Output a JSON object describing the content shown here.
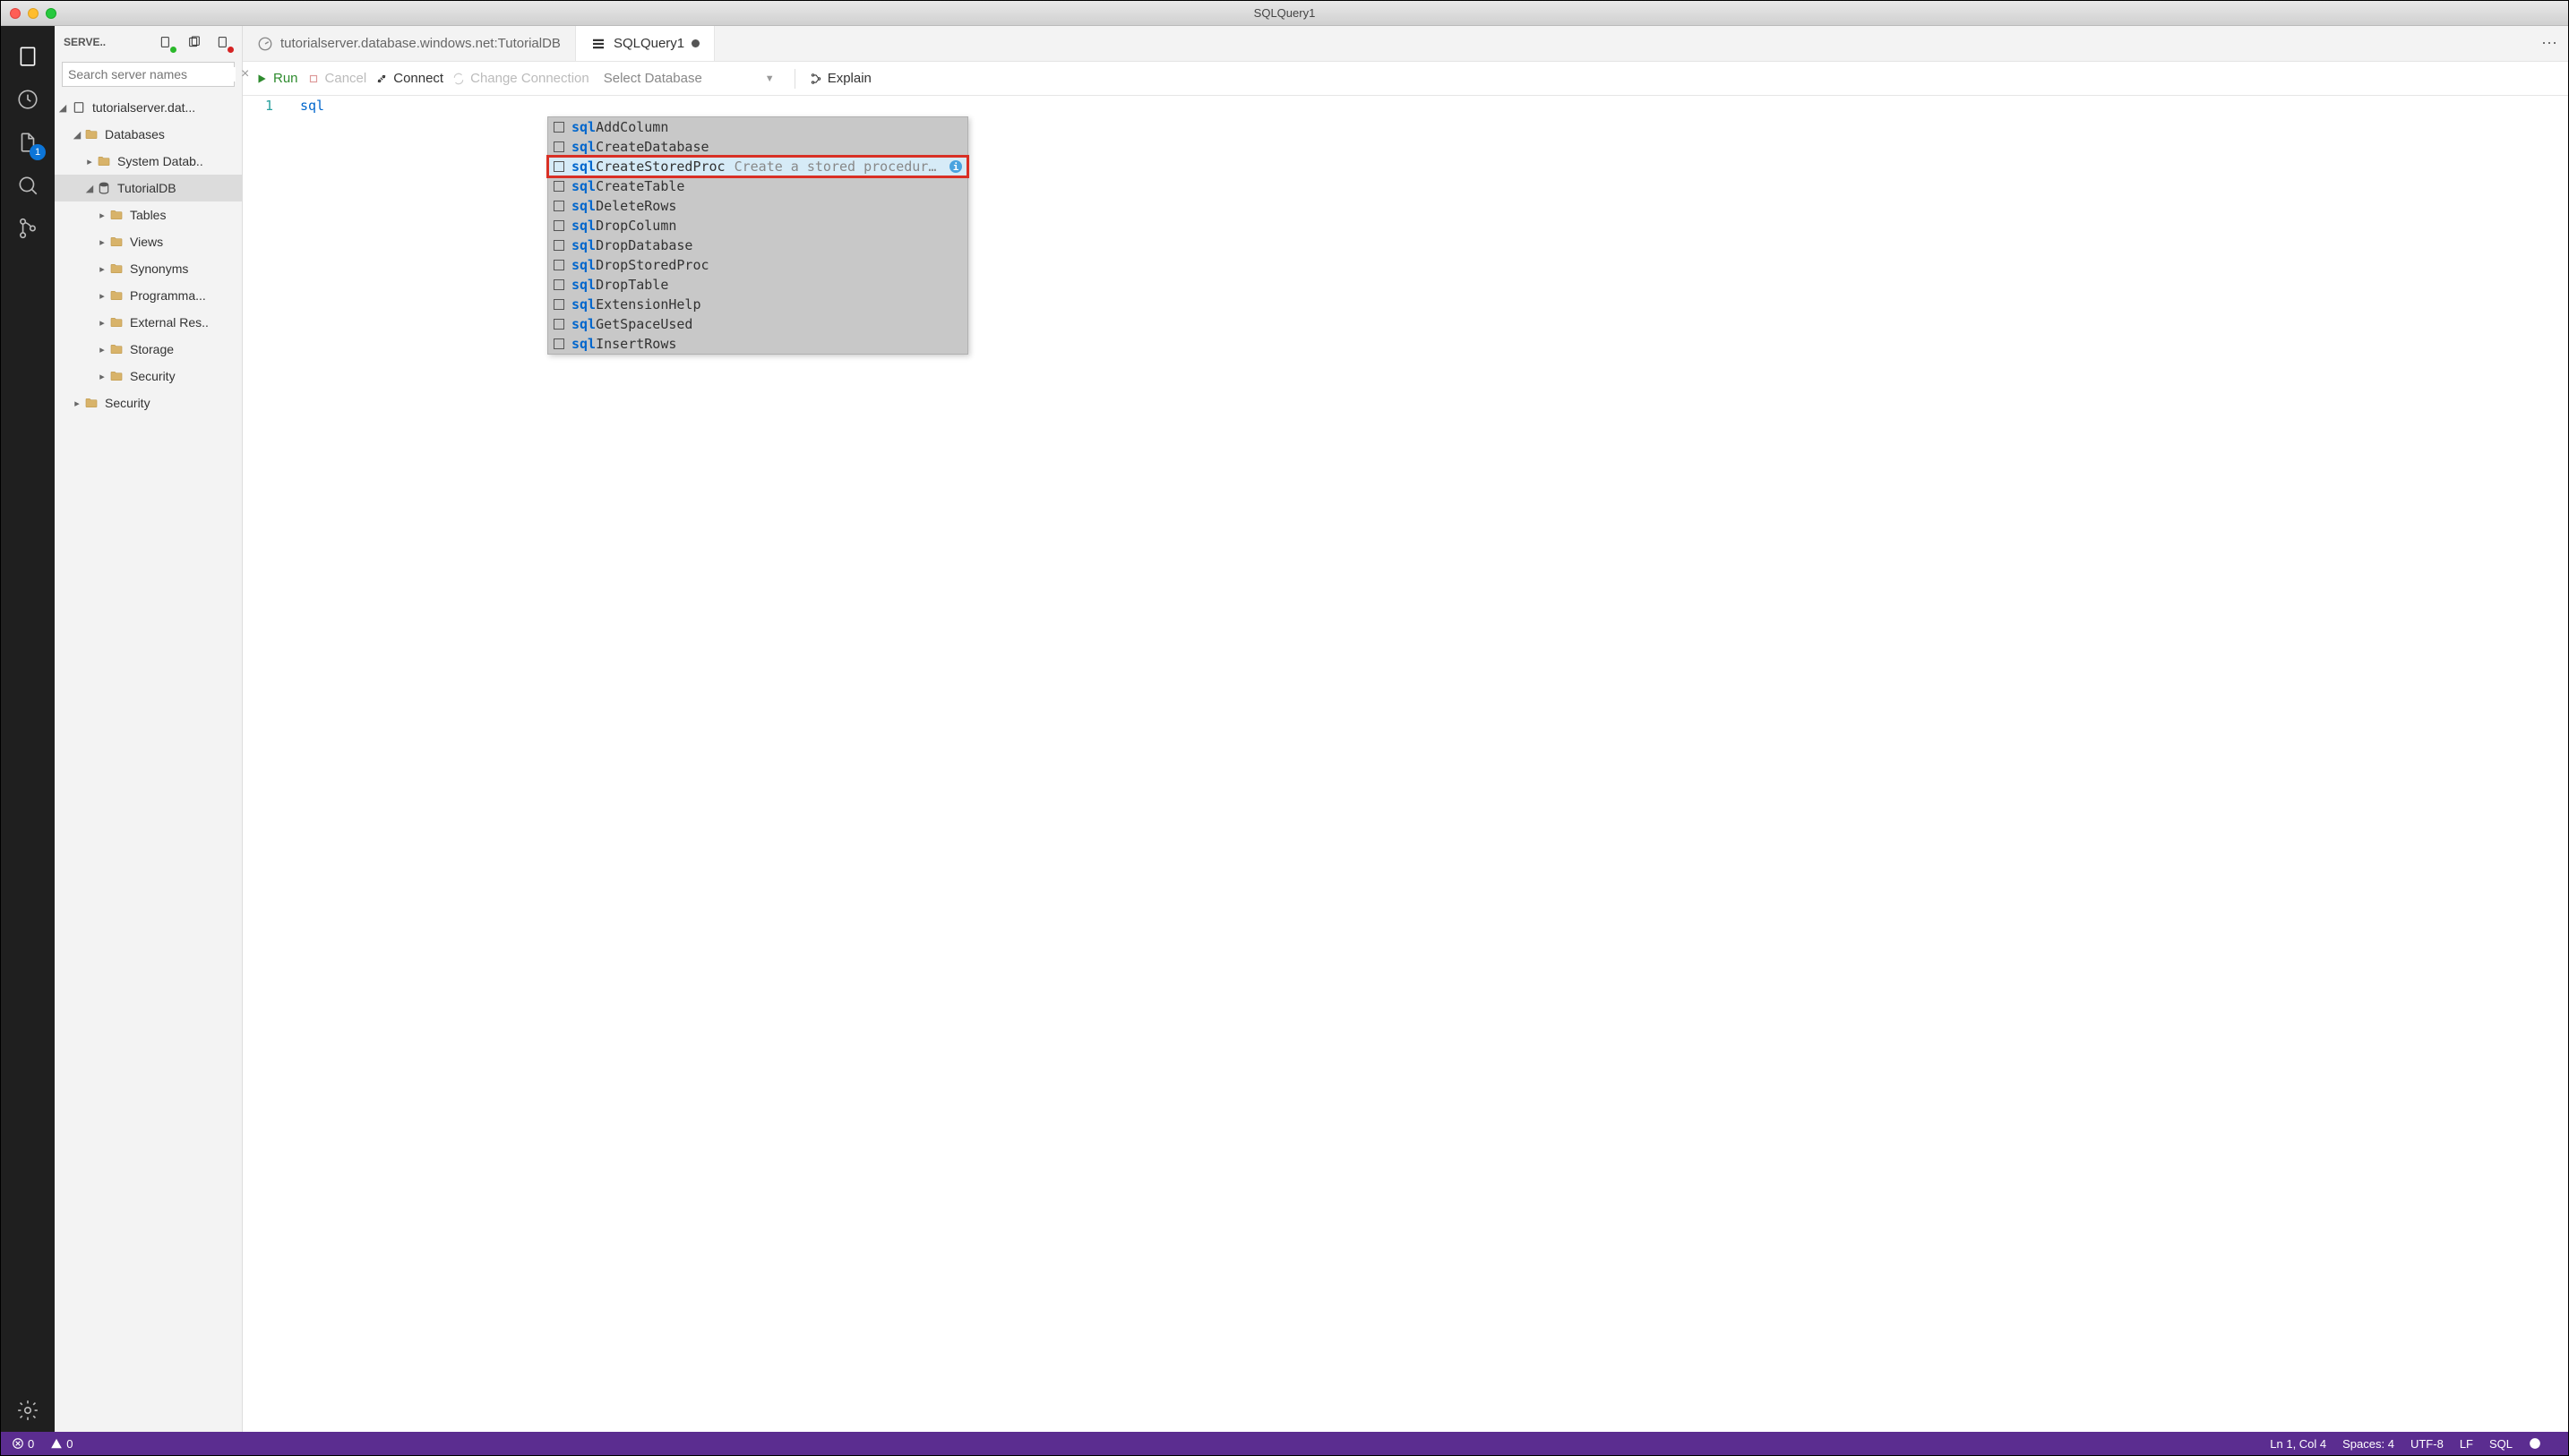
{
  "window": {
    "title": "SQLQuery1"
  },
  "activityBar": {
    "badge": "1"
  },
  "sidebar": {
    "headerLabel": "SERVE..",
    "searchPlaceholder": "Search server names",
    "tree": {
      "server": "tutorialserver.dat...",
      "databases": "Databases",
      "systemDatabases": "System Datab..",
      "tutorialDb": "TutorialDB",
      "tables": "Tables",
      "views": "Views",
      "synonyms": "Synonyms",
      "programmability": "Programma...",
      "externalResources": "External Res..",
      "storage": "Storage",
      "securityDb": "Security",
      "security": "Security"
    }
  },
  "tabs": {
    "tab1": "tutorialserver.database.windows.net:TutorialDB",
    "tab2": "SQLQuery1"
  },
  "toolbar": {
    "run": "Run",
    "cancel": "Cancel",
    "connect": "Connect",
    "changeConnection": "Change Connection",
    "selectDatabase": "Select Database",
    "explain": "Explain"
  },
  "editor": {
    "lineNumber": "1",
    "code": "sql"
  },
  "autocomplete": {
    "match": "sql",
    "items": [
      {
        "rest": "AddColumn",
        "hint": "",
        "selected": false
      },
      {
        "rest": "CreateDatabase",
        "hint": "",
        "selected": false
      },
      {
        "rest": "CreateStoredProc",
        "hint": "Create a stored procedure (mssq…",
        "selected": true,
        "highlighted": true,
        "info": true
      },
      {
        "rest": "CreateTable",
        "hint": "",
        "selected": false
      },
      {
        "rest": "DeleteRows",
        "hint": "",
        "selected": false
      },
      {
        "rest": "DropColumn",
        "hint": "",
        "selected": false
      },
      {
        "rest": "DropDatabase",
        "hint": "",
        "selected": false
      },
      {
        "rest": "DropStoredProc",
        "hint": "",
        "selected": false
      },
      {
        "rest": "DropTable",
        "hint": "",
        "selected": false
      },
      {
        "rest": "ExtensionHelp",
        "hint": "",
        "selected": false
      },
      {
        "rest": "GetSpaceUsed",
        "hint": "",
        "selected": false
      },
      {
        "rest": "InsertRows",
        "hint": "",
        "selected": false
      }
    ]
  },
  "statusbar": {
    "errors": "0",
    "warnings": "0",
    "lineCol": "Ln 1, Col 4",
    "spaces": "Spaces: 4",
    "encoding": "UTF-8",
    "eol": "LF",
    "lang": "SQL"
  }
}
